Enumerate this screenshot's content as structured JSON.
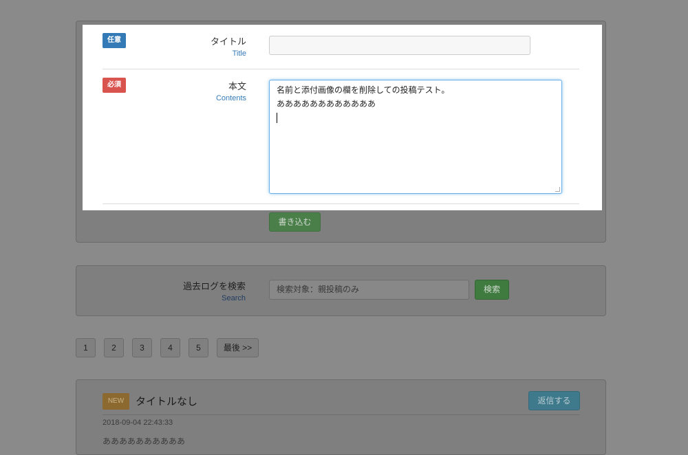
{
  "form": {
    "title_badge": "任意",
    "title_label": "タイトル",
    "title_label_en": "Title",
    "title_value": "",
    "body_badge": "必須",
    "body_label": "本文",
    "body_label_en": "Contents",
    "body_lines": [
      "名前と添付画像の欄を削除しての投稿テスト。",
      "ああああああああああああ"
    ],
    "submit_label": "書き込む"
  },
  "search": {
    "label": "過去ログを検索",
    "label_en": "Search",
    "placeholder": "検索対象：親投稿のみ",
    "button_label": "検索"
  },
  "pagination": {
    "pages": [
      "1",
      "2",
      "3",
      "4",
      "5"
    ],
    "last_label": "最後 >>"
  },
  "post": {
    "new_badge": "NEW",
    "title": "タイトルなし",
    "reply_label": "返信する",
    "date": "2018-09-04 22:43:33",
    "body_preview": "ああああああああああ"
  },
  "colors": {
    "optional_badge": "#337ab7",
    "required_badge": "#d9534f",
    "focus_border": "#66afe9",
    "submit_green": "#5cb85c",
    "reply_info": "#5bc0de",
    "new_badge": "#f0ad4e"
  }
}
